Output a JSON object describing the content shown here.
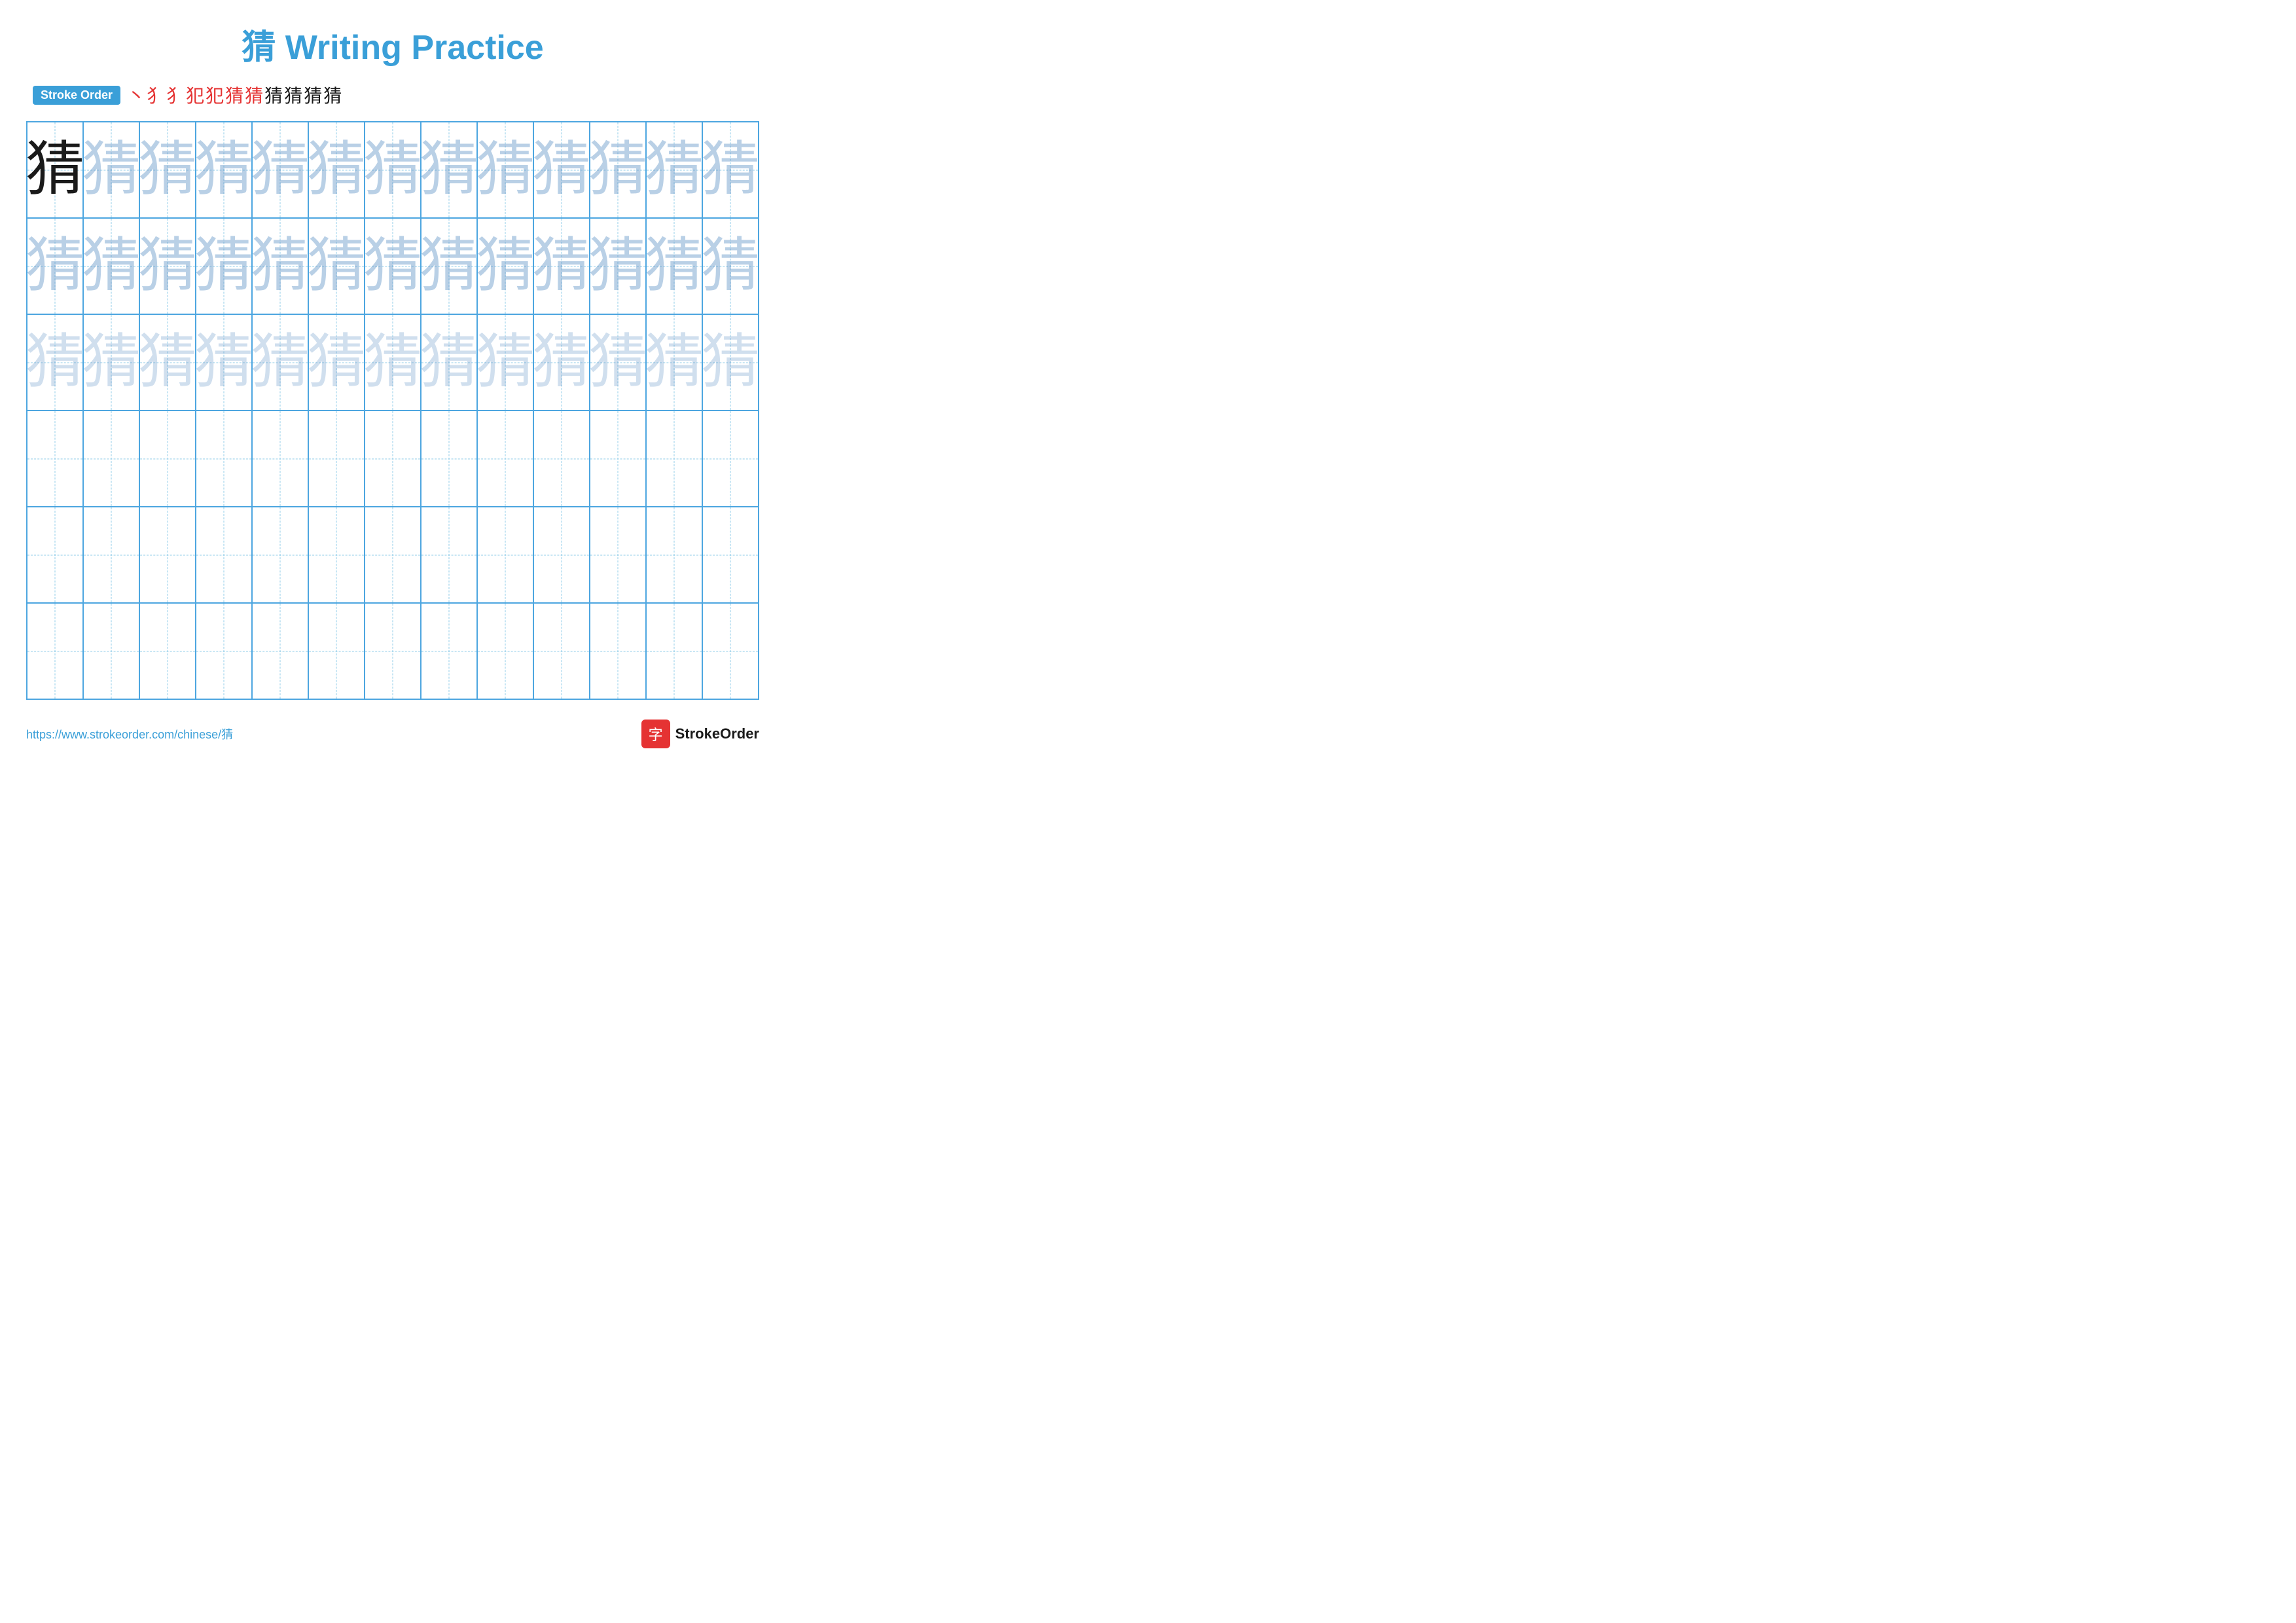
{
  "title": "猜 Writing Practice",
  "stroke_order": {
    "badge_label": "Stroke Order",
    "strokes": [
      "丶",
      "犭",
      "犭",
      "犯",
      "犯",
      "猜",
      "猜",
      "猜",
      "猜",
      "猜",
      "猜"
    ]
  },
  "character": "猜",
  "grid": {
    "rows": 6,
    "cols": 13
  },
  "footer": {
    "url": "https://www.strokeorder.com/chinese/猜",
    "logo_char": "字",
    "logo_text": "StrokeOrder"
  }
}
